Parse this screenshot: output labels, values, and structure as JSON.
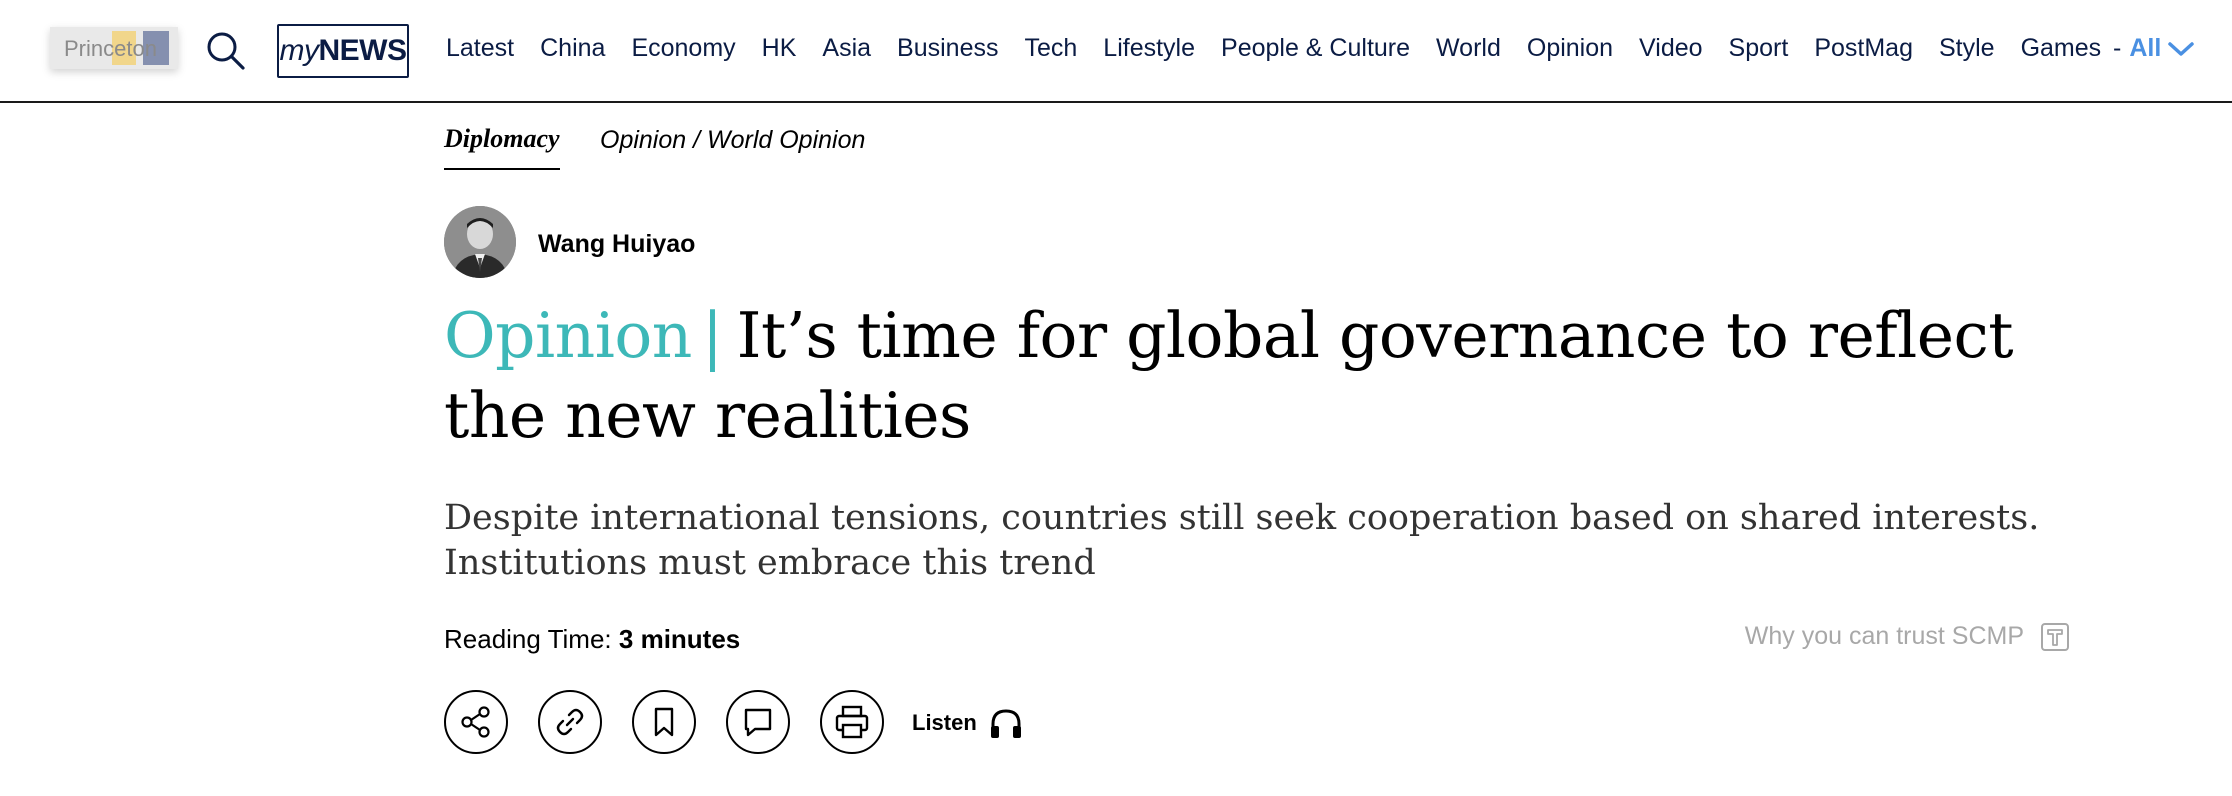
{
  "header": {
    "princeton_badge": "Princeton",
    "mynews_logo": {
      "my": "my",
      "news": "NEWS"
    },
    "nav_links": [
      "Latest",
      "China",
      "Economy",
      "HK",
      "Asia",
      "Business",
      "Tech",
      "Lifestyle",
      "People & Culture",
      "World",
      "Opinion",
      "Video",
      "Sport",
      "PostMag",
      "Style",
      "Games"
    ],
    "nav_separator": "-",
    "nav_all_label": "All",
    "icons": {
      "search": "search-icon",
      "all_chevron": "chevron-down-icon"
    }
  },
  "article": {
    "section_primary": "Diplomacy",
    "section_secondary": "Opinion / World Opinion",
    "author_name": "Wang Huiyao",
    "headline_kicker": "Opinion",
    "headline_separator": "|",
    "headline": "It’s time for global governance to reflect the new realities",
    "subheadline": "Despite international tensions, countries still seek cooperation based on shared interests. Institutions must embrace this trend",
    "reading_time_label": "Reading Time:",
    "reading_time_value": "3 minutes",
    "trust_link": "Why you can trust SCMP",
    "listen_label": "Listen",
    "action_icons": [
      "share-icon",
      "link-icon",
      "bookmark-icon",
      "comment-icon",
      "print-icon",
      "headphones-icon"
    ]
  },
  "colors": {
    "nav_text": "#0b1c44",
    "accent_all": "#4a90e2",
    "opinion_teal": "#3db8b8",
    "muted_text": "#a8a8a8"
  }
}
